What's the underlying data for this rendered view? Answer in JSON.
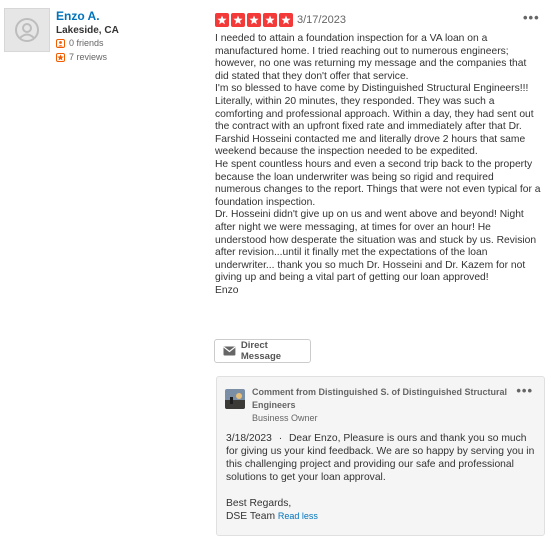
{
  "user": {
    "name": "Enzo A.",
    "location": "Lakeside, CA",
    "friends": "0 friends",
    "reviews": "7 reviews",
    "avatar_icon": "default-user-avatar-icon"
  },
  "review": {
    "rating": 5,
    "star_color": "#f43939",
    "date": "3/17/2023",
    "text": "I needed to attain a foundation inspection for a VA loan on a manufactured home. I tried reaching out to numerous engineers; however, no one was returning my message and the companies that did stated that they don't offer that service.\nI'm so blessed to have come by Distinguished Structural Engineers!!! Literally, within 20 minutes, they responded. They was such a comforting and professional approach. Within a day, they had sent out the contract with an upfront fixed rate and immediately after that Dr. Farshid Hosseini contacted me and literally drove 2 hours that same weekend because the inspection needed to be expedited.\nHe spent countless hours and even a second trip back to the property because the loan underwriter was being so rigid and required numerous changes to the report. Things that were not even typical for a foundation inspection.\nDr. Hosseini didn't give up on us and went above and beyond! Night after night we were messaging, at times for over an hour! He understood how desperate the situation was and stuck by us. Revision after revision...until it finally met the expectations of the loan underwriter... thank you so much Dr. Hosseini and Dr. Kazem for not giving up and being a vital part of getting our loan approved!\nEnzo",
    "more_icon": "more-options-icon"
  },
  "actions": {
    "direct_message": "Direct Message"
  },
  "owner_comment": {
    "heading": "Comment from Distinguished S. of Distinguished Structural Engineers",
    "role": "Business Owner",
    "date": "3/18/2023",
    "separator": "·",
    "text": "Dear Enzo, Pleasure is ours and thank you so much for giving us your kind feedback. We are so happy by serving you in this challenging project and providing our safe and professional solutions to get your loan approval.",
    "closing": "Best Regards,",
    "signature": "DSE Team",
    "read_less": "Read less"
  }
}
